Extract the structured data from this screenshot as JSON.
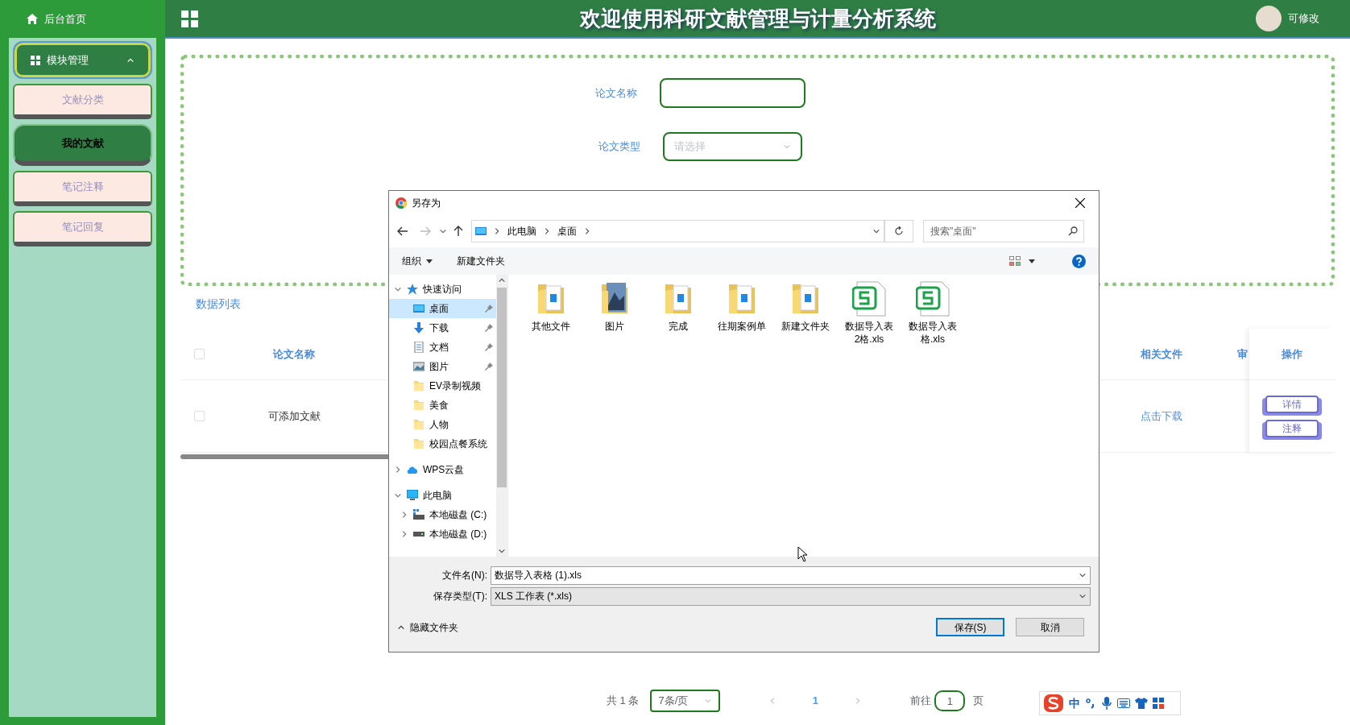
{
  "sidebar": {
    "home": "后台首页",
    "group": {
      "label": "模块管理",
      "expanded": true,
      "items": [
        {
          "label": "文献分类",
          "selected": false
        },
        {
          "label": "我的文献",
          "selected": true
        },
        {
          "label": "笔记注释",
          "selected": false
        },
        {
          "label": "笔记回复",
          "selected": false
        }
      ]
    }
  },
  "header": {
    "title": "欢迎使用科研文献管理与计量分析系统",
    "user": "可修改"
  },
  "search_form": {
    "fields": [
      {
        "label": "论文名称",
        "kind": "text"
      },
      {
        "label": "论文类型",
        "kind": "select",
        "placeholder": "请选择"
      }
    ]
  },
  "list_title": "数据列表",
  "table": {
    "columns": [
      "论文名称",
      "相关文件",
      "审",
      "操作"
    ],
    "header_checked": false,
    "rows": [
      {
        "checked": false,
        "name": "可添加文献",
        "file": "点击下载",
        "actions": [
          "详情",
          "注释"
        ]
      }
    ]
  },
  "pagination": {
    "total": "共 1 条",
    "page_size": "7条/页",
    "pages": [
      {
        "label": "1",
        "selected": true
      }
    ],
    "goto_label": "前往",
    "goto_value": "1",
    "goto_suffix": "页"
  },
  "ime_toolbar": {
    "mode": "中"
  },
  "save_dialog": {
    "title": "另存为",
    "path": [
      "此电脑",
      "桌面"
    ],
    "search_placeholder": "搜索\"桌面\"",
    "toolbar": [
      "组织",
      "新建文件夹"
    ],
    "tree": [
      {
        "label": "快速访问",
        "kind": "star",
        "expanded": true,
        "selected": false,
        "children": [
          {
            "label": "桌面",
            "kind": "desktop",
            "pinned": true,
            "selected": true
          },
          {
            "label": "下载",
            "kind": "download",
            "pinned": true,
            "selected": false
          },
          {
            "label": "文档",
            "kind": "document",
            "pinned": true,
            "selected": false
          },
          {
            "label": "图片",
            "kind": "picture",
            "pinned": true,
            "selected": false
          },
          {
            "label": "EV录制视频",
            "kind": "folder",
            "pinned": false,
            "selected": false
          },
          {
            "label": "美食",
            "kind": "folder",
            "pinned": false,
            "selected": false
          },
          {
            "label": "人物",
            "kind": "folder",
            "pinned": false,
            "selected": false
          },
          {
            "label": "校园点餐系统",
            "kind": "folder",
            "pinned": false,
            "selected": false
          }
        ]
      },
      {
        "label": "WPS云盘",
        "kind": "cloud",
        "expanded": false,
        "selected": false
      },
      {
        "label": "此电脑",
        "kind": "computer",
        "expanded": true,
        "selected": false,
        "children": [
          {
            "label": "本地磁盘 (C:)",
            "kind": "system-drive",
            "expanded": false,
            "selected": false
          },
          {
            "label": "本地磁盘 (D:)",
            "kind": "drive",
            "expanded": false,
            "selected": false
          }
        ]
      }
    ],
    "files": [
      {
        "name": "其他文件",
        "kind": "folder"
      },
      {
        "name": "图片",
        "kind": "picture-folder"
      },
      {
        "name": "完成",
        "kind": "folder"
      },
      {
        "name": "往期案例单",
        "kind": "folder"
      },
      {
        "name": "新建文件夹",
        "kind": "folder"
      },
      {
        "name": "数据导入表2格.xls",
        "kind": "spreadsheet"
      },
      {
        "name": "数据导入表格.xls",
        "kind": "spreadsheet"
      }
    ],
    "filename_label": "文件名(N):",
    "filename": "数据导入表格 (1).xls",
    "type_label": "保存类型(T):",
    "type": "XLS 工作表 (*.xls)",
    "hide_folders": "隐藏文件夹",
    "buttons": [
      {
        "label": "保存(S)",
        "kind": "primary"
      },
      {
        "label": "取消",
        "kind": "default"
      }
    ]
  }
}
